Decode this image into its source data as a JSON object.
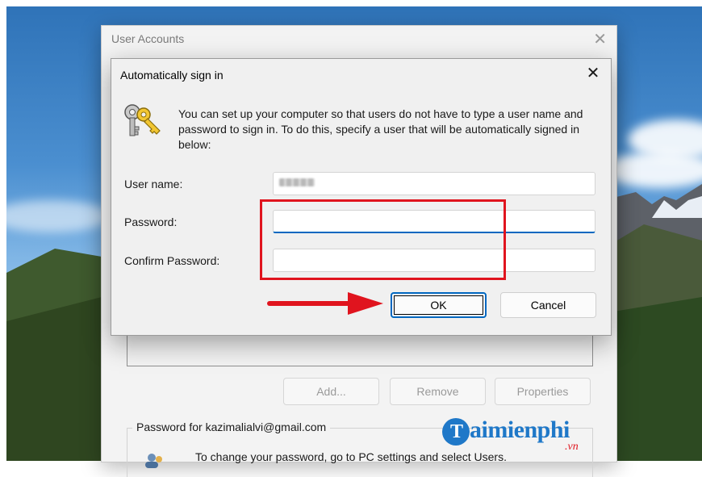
{
  "back_window": {
    "title": "User Accounts",
    "close_glyph": "✕",
    "buttons": {
      "add": "Add...",
      "remove": "Remove",
      "properties": "Properties"
    },
    "password_group_label": "Password for kazimalialvi@gmail.com",
    "password_note": "To change your password, go to PC settings and select Users."
  },
  "dialog": {
    "title": "Automatically sign in",
    "close_glyph": "✕",
    "description": "You can set up your computer so that users do not have to type a user name and password to sign in. To do this, specify a user that will be automatically signed in below:",
    "fields": {
      "user_name": {
        "label": "User name:",
        "value": ""
      },
      "password": {
        "label": "Password:",
        "value": ""
      },
      "confirm_password": {
        "label": "Confirm Password:",
        "value": ""
      }
    },
    "buttons": {
      "ok": "OK",
      "cancel": "Cancel"
    }
  },
  "watermark": {
    "logo_letter": "T",
    "brand": "aimienphi",
    "tld": ".vn"
  },
  "colors": {
    "accent": "#0067c0",
    "annotation": "#e0141e",
    "watermark": "#1f78c8"
  },
  "icons": [
    "keys-icon",
    "close-icon",
    "user-icon",
    "arrow-right-icon"
  ]
}
